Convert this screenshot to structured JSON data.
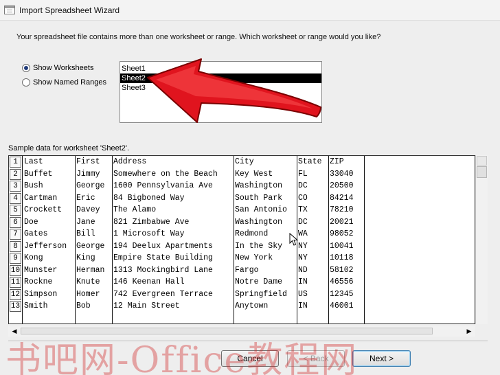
{
  "window": {
    "title": "Import Spreadsheet Wizard"
  },
  "instruction": "Your spreadsheet file contains more than one worksheet or range. Which worksheet or range would you like?",
  "options": {
    "show_worksheets": "Show Worksheets",
    "show_named_ranges": "Show Named Ranges",
    "selected": "show_worksheets"
  },
  "sheets": [
    "Sheet1",
    "Sheet2",
    "Sheet3"
  ],
  "selected_sheet": "Sheet2",
  "sample_label": "Sample data for worksheet 'Sheet2'.",
  "table": {
    "headers": [
      "Last",
      "First",
      "Address",
      "City",
      "State",
      "ZIP"
    ],
    "rows": [
      [
        "Buffet",
        "Jimmy",
        "Somewhere on the Beach",
        "Key West",
        "FL",
        "33040"
      ],
      [
        "Bush",
        "George",
        "1600 Pennsylvania Ave",
        "Washington",
        "DC",
        "20500"
      ],
      [
        "Cartman",
        "Eric",
        "84 Bigboned Way",
        "South Park",
        "CO",
        "84214"
      ],
      [
        "Crockett",
        "Davey",
        "The Alamo",
        "San Antonio",
        "TX",
        "78210"
      ],
      [
        "Doe",
        "Jane",
        "821 Zimbabwe Ave",
        "Washington",
        "DC",
        "20021"
      ],
      [
        "Gates",
        "Bill",
        "1 Microsoft Way",
        "Redmond",
        "WA",
        "98052"
      ],
      [
        "Jefferson",
        "George",
        "194 Deelux Apartments",
        "In the Sky",
        "NY",
        "10041"
      ],
      [
        "Kong",
        "King",
        "Empire State Building",
        "New York",
        "NY",
        "10118"
      ],
      [
        "Munster",
        "Herman",
        "1313 Mockingbird Lane",
        "Fargo",
        "ND",
        "58102"
      ],
      [
        "Rockne",
        "Knute",
        "146 Keenan Hall",
        "Notre Dame",
        "IN",
        "46556"
      ],
      [
        "Simpson",
        "Homer",
        "742 Evergreen Terrace",
        "Springfield",
        "US",
        "12345"
      ],
      [
        "Smith",
        "Bob",
        "12 Main Street",
        "Anytown",
        "IN",
        "46001"
      ]
    ]
  },
  "buttons": {
    "cancel": "Cancel",
    "back": "< Back",
    "next": "Next >"
  },
  "watermark": "书吧网-Office教程网",
  "colors": {
    "arrow": "#e0141e",
    "selection": "#000000",
    "radio_dot": "#1f3a7a",
    "default_button_border": "#3c7fb1"
  },
  "icons": {
    "app": "datasheet-icon",
    "scroll_left": "left-arrow-icon",
    "scroll_right": "right-arrow-icon"
  }
}
